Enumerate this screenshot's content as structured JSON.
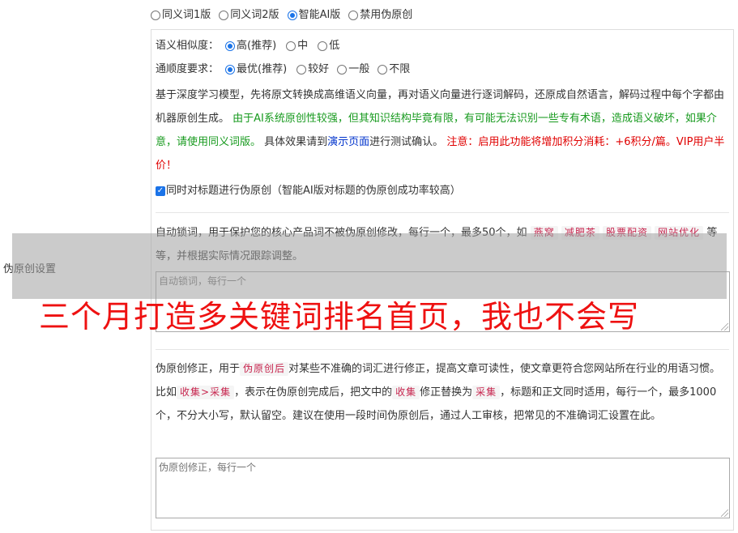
{
  "side_label": "伪原创设置",
  "mode_options": [
    {
      "label": "同义词1版",
      "checked": false
    },
    {
      "label": "同义词2版",
      "checked": false
    },
    {
      "label": "智能AI版",
      "checked": true
    },
    {
      "label": "禁用伪原创",
      "checked": false
    }
  ],
  "similarity": {
    "label": "语义相似度：",
    "options": [
      {
        "label": "高(推荐)",
        "checked": true
      },
      {
        "label": "中",
        "checked": false
      },
      {
        "label": "低",
        "checked": false
      }
    ]
  },
  "fluency": {
    "label": "通顺度要求：",
    "options": [
      {
        "label": "最优(推荐)",
        "checked": true
      },
      {
        "label": "较好",
        "checked": false
      },
      {
        "label": "一般",
        "checked": false
      },
      {
        "label": "不限",
        "checked": false
      }
    ]
  },
  "ai_description": {
    "part1": "基于深度学习模型，先将原文转换成高维语义向量，再对语义向量进行逐词解码，还原成自然语言，解码过程中每个字都由机器原创生成。 ",
    "part2_green": "由于AI系统原创性较强，但其知识结构毕竟有限，有可能无法识别一些专有术语，造成语义破坏，如果介意，请使用同义词版。",
    "part3": " 具体效果请到",
    "demo_link": "演示页面",
    "part4": "进行测试确认。 ",
    "part5_red": "注意：启用此功能将增加积分消耗：+6积分/篇。VIP用户半价！"
  },
  "title_checkbox": {
    "label": "同时对标题进行伪原创（智能AI版对标题的伪原创成功率较高）",
    "checked": true
  },
  "lock_words": {
    "text1": "自动锁词，用于保护您的核心产品词不被伪原创修改，每行一个，最多50个，如",
    "tags": [
      "燕窝",
      "减肥茶",
      "股票配资",
      "网站优化"
    ],
    "text2": "等等，并根据实际情况跟踪调整。",
    "placeholder": "自动锁词，每行一个"
  },
  "correction": {
    "text1": "伪原创修正，用于",
    "tag1": "伪原创后",
    "text2": "对某些不准确的词汇进行修正，提高文章可读性，使文章更符合您网站所在行业的用语习惯。比如",
    "tag2": "收集>采集",
    "text3": "，表示在伪原创完成后，把文中的",
    "tag3": "收集",
    "text4": "修正替换为",
    "tag4": "采集",
    "text5": "，标题和正文同时适用，每行一个，最多1000个，不分大小写，默认留空。建议在使用一段时间伪原创后，通过人工审核，把常见的不准确词汇设置在此。",
    "placeholder": "伪原创修正，每行一个"
  },
  "overlay_caption": "三个月打造多关键词排名首页，我也不会写",
  "colors": {
    "accent": "#1a73e8",
    "green": "#179a1e",
    "red": "#e00000",
    "link": "#0033cc",
    "tag_text": "#c7254e",
    "overlay_text": "#ee1111"
  }
}
